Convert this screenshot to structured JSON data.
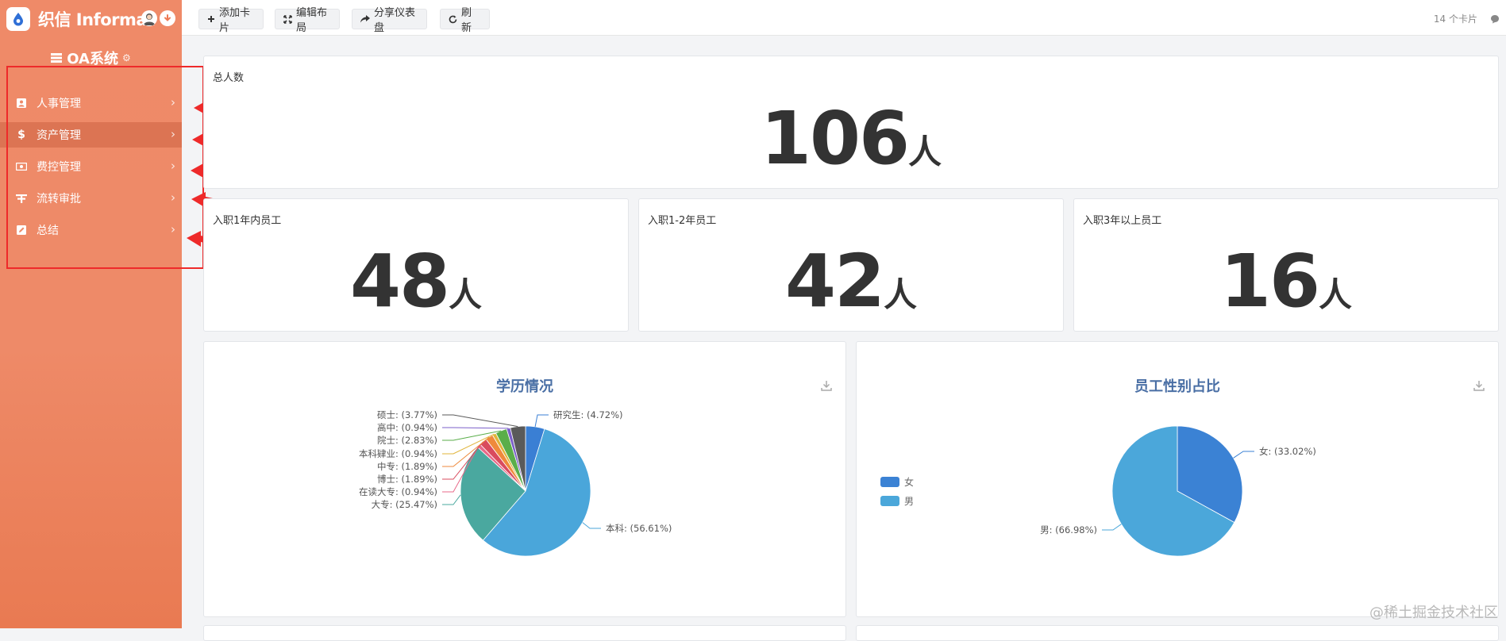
{
  "brand": {
    "name": "织信 Informat"
  },
  "app": {
    "title": "OA系统"
  },
  "sidebar": {
    "items": [
      {
        "label": "人事管理",
        "icon": "person-badge-icon"
      },
      {
        "label": "资产管理",
        "icon": "dollar-icon",
        "active": true
      },
      {
        "label": "费控管理",
        "icon": "money-icon"
      },
      {
        "label": "流转审批",
        "icon": "approval-icon"
      },
      {
        "label": "总结",
        "icon": "edit-icon"
      }
    ]
  },
  "toolbar": {
    "add_card": "添加卡片",
    "edit_layout": "编辑布局",
    "share": "分享仪表盘",
    "refresh": "刷新",
    "card_count": "14 个卡片"
  },
  "stats": {
    "total": {
      "title": "总人数",
      "value": "106",
      "unit": "人"
    },
    "within_1yr": {
      "title": "入职1年内员工",
      "value": "48",
      "unit": "人"
    },
    "one_to_two": {
      "title": "入职1-2年员工",
      "value": "42",
      "unit": "人"
    },
    "over_3yr": {
      "title": "入职3年以上员工",
      "value": "16",
      "unit": "人"
    }
  },
  "chart_data": [
    {
      "type": "pie",
      "title": "学历情况",
      "slices": [
        {
          "name": "研究生",
          "value": 4.72,
          "label": "研究生: (4.72%)",
          "color": "#3a7fd4"
        },
        {
          "name": "本科",
          "value": 56.61,
          "label": "本科: (56.61%)",
          "color": "#4aa6da"
        },
        {
          "name": "大专",
          "value": 25.47,
          "label": "大专: (25.47%)",
          "color": "#4aa89f"
        },
        {
          "name": "在读大专",
          "value": 0.94,
          "label": "在读大专: (0.94%)",
          "color": "#e86a8a"
        },
        {
          "name": "博士",
          "value": 1.89,
          "label": "博士: (1.89%)",
          "color": "#d94b5e"
        },
        {
          "name": "中专",
          "value": 1.89,
          "label": "中专: (1.89%)",
          "color": "#ef8a3c"
        },
        {
          "name": "本科肄业",
          "value": 0.94,
          "label": "本科肄业: (0.94%)",
          "color": "#e0b43a"
        },
        {
          "name": "院士",
          "value": 2.83,
          "label": "院士: (2.83%)",
          "color": "#5aae4a"
        },
        {
          "name": "高中",
          "value": 0.94,
          "label": "高中: (0.94%)",
          "color": "#7b5fc9"
        },
        {
          "name": "硕士",
          "value": 3.77,
          "label": "硕士: (3.77%)",
          "color": "#5a5a5a"
        }
      ]
    },
    {
      "type": "pie",
      "title": "员工性别占比",
      "legend": [
        "女",
        "男"
      ],
      "legend_position": "left",
      "slices": [
        {
          "name": "女",
          "value": 33.02,
          "label": "女: (33.02%)",
          "color": "#3b82d4"
        },
        {
          "name": "男",
          "value": 66.98,
          "label": "男: (66.98%)",
          "color": "#4ba7da"
        }
      ]
    }
  ],
  "watermark": "@稀土掘金技术社区",
  "colors": {
    "sidebar": "#ee8a68",
    "annotation": "#ee2a2a"
  }
}
